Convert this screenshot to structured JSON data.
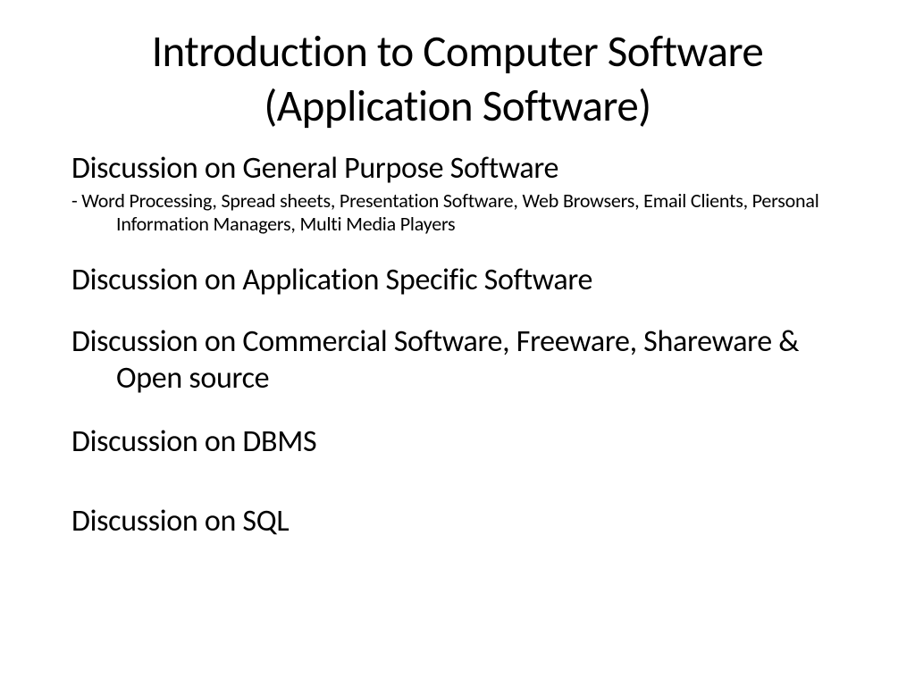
{
  "slide": {
    "title": "Introduction to Computer Software (Application Software)",
    "topics": {
      "general_purpose": "Discussion on General Purpose Software",
      "general_purpose_sub": "- Word Processing, Spread sheets, Presentation Software, Web Browsers, Email Clients, Personal Information Managers, Multi Media Players",
      "app_specific": "Discussion on Application Specific Software",
      "commercial": "Discussion on Commercial Software, Freeware, Shareware & Open source",
      "dbms": "Discussion on DBMS",
      "sql": "Discussion on SQL"
    }
  }
}
